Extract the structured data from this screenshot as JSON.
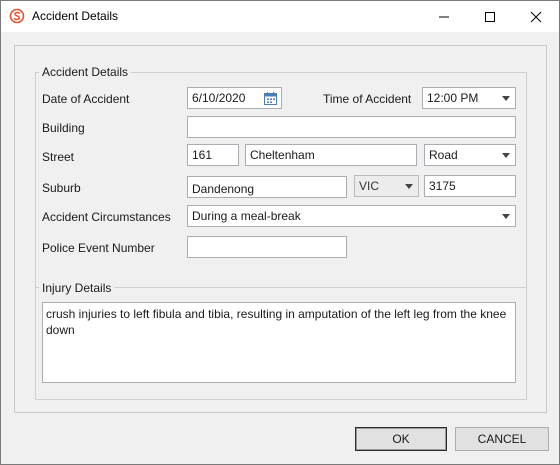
{
  "window": {
    "title": "Accident Details",
    "icon": "app-logo-icon",
    "controls": [
      "minimize-icon",
      "maximize-icon",
      "close-icon"
    ]
  },
  "accident": {
    "group_label": "Accident Details",
    "date_label": "Date of Accident",
    "date_value": "6/10/2020",
    "time_label": "Time of Accident",
    "time_value": "12:00 PM",
    "building_label": "Building",
    "building_value": "",
    "street_label": "Street",
    "street_number": "161",
    "street_name": "Cheltenham",
    "street_type": "Road",
    "suburb_label": "Suburb",
    "suburb_value": "Dandenong",
    "state_value": "VIC",
    "postcode_value": "3175",
    "circumstances_label": "Accident Circumstances",
    "circumstances_value": "During a meal-break",
    "police_label": "Police Event Number",
    "police_value": ""
  },
  "injury": {
    "group_label": "Injury Details",
    "text": "crush injuries to left fibula and tibia, resulting in amputation of the left leg from the knee down"
  },
  "buttons": {
    "ok": "OK",
    "cancel": "CANCEL"
  },
  "colors": {
    "logo": "#e8522b",
    "window_bg": "#f0f0f0",
    "field_border": "#abadb3"
  }
}
